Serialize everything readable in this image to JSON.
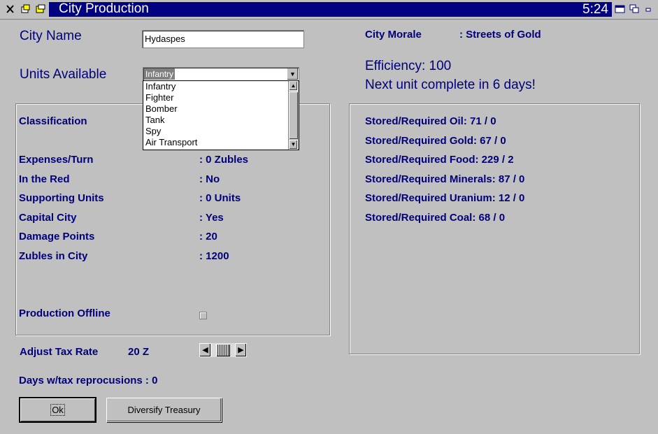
{
  "window": {
    "title": "City Production",
    "clock": "5:24"
  },
  "city_name": {
    "label": "City Name",
    "value": "Hydaspes"
  },
  "units_available": {
    "label": "Units Available",
    "selected": "Infantry",
    "options": [
      "Infantry",
      "Fighter",
      "Bomber",
      "Tank",
      "Spy",
      "Air Transport"
    ]
  },
  "morale": {
    "label": "City Morale",
    "value": ": Streets of Gold"
  },
  "efficiency": "Efficiency: 100",
  "next_unit": "Next unit complete in 6 days!",
  "left_panel": {
    "classification": "Classification",
    "rows": [
      {
        "label": "Expenses/Turn",
        "value": ": 0  Zubles"
      },
      {
        "label": "In the Red",
        "value": ": No"
      },
      {
        "label": "Supporting Units",
        "value": ": 0  Units"
      },
      {
        "label": "Capital City",
        "value": ": Yes"
      },
      {
        "label": "Damage Points",
        "value": ": 20"
      },
      {
        "label": "Zubles in City",
        "value": ": 1200"
      }
    ],
    "production_offline": {
      "label": "Production Offline",
      "checked": false
    }
  },
  "resources": [
    "Stored/Required Oil:  71 / 0",
    "Stored/Required Gold:  67 / 0",
    "Stored/Required Food:  229 / 2",
    "Stored/Required Minerals:  87 / 0",
    "Stored/Required Uranium:  12 / 0",
    "Stored/Required Coal:  68 / 0"
  ],
  "tax": {
    "label": "Adjust Tax Rate",
    "value": "20 Z"
  },
  "days_tax": "Days w/tax reprocusions  :  0",
  "buttons": {
    "ok": "Ok",
    "diversify": "Diversify Treasury"
  },
  "colors": {
    "title_bar": "#000080",
    "text": "#00007b",
    "background": "#c0c0c0"
  }
}
